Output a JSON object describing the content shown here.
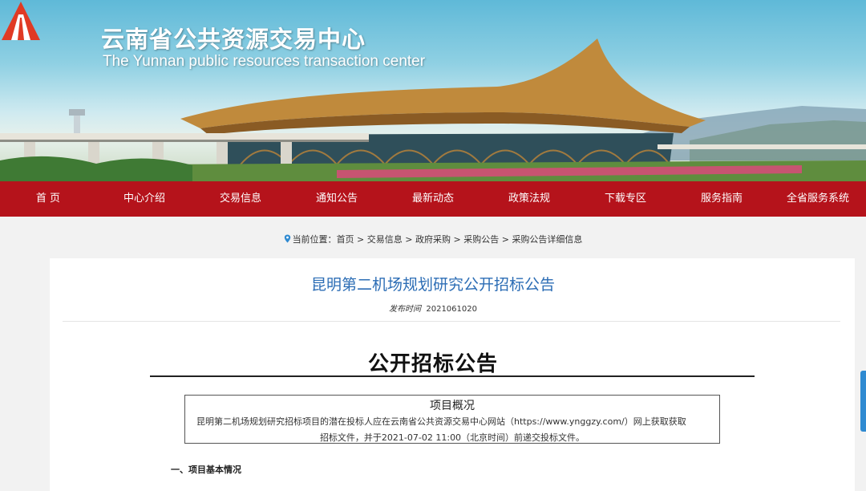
{
  "header": {
    "title": "云南省公共资源交易中心",
    "subtitle": "The Yunnan public resources transaction center",
    "logo_icon": "red-triangle-road-logo",
    "colors": {
      "logo_red": "#e03a24",
      "nav_red": "#b5131b"
    }
  },
  "nav": {
    "items": [
      {
        "label": "首 页"
      },
      {
        "label": "中心介绍"
      },
      {
        "label": "交易信息"
      },
      {
        "label": "通知公告"
      },
      {
        "label": "最新动态"
      },
      {
        "label": "政策法规"
      },
      {
        "label": "下载专区"
      },
      {
        "label": "服务指南"
      },
      {
        "label": "全省服务系统"
      }
    ]
  },
  "breadcrumb": {
    "icon": "location-pin-icon",
    "prefix": "当前位置：",
    "items": [
      "首页",
      "交易信息",
      "政府采购",
      "采购公告",
      "采购公告详细信息"
    ],
    "separator": " > "
  },
  "article": {
    "title": "昆明第二机场规划研究公开招标公告",
    "publish_label": "发布时间",
    "publish_value": "2021061020",
    "heading": "公开招标公告",
    "overview": {
      "title": "项目概况",
      "line1": "昆明第二机场规划研究招标项目的潜在投标人应在云南省公共资源交易中心网站（https://www.ynggzy.com/）网上获取获取",
      "line2": "招标文件，并于2021-07-02 11:00（北京时间）前递交投标文件。"
    },
    "section1": "一、项目基本情况",
    "colors": {
      "title_blue": "#2c6db5"
    }
  }
}
